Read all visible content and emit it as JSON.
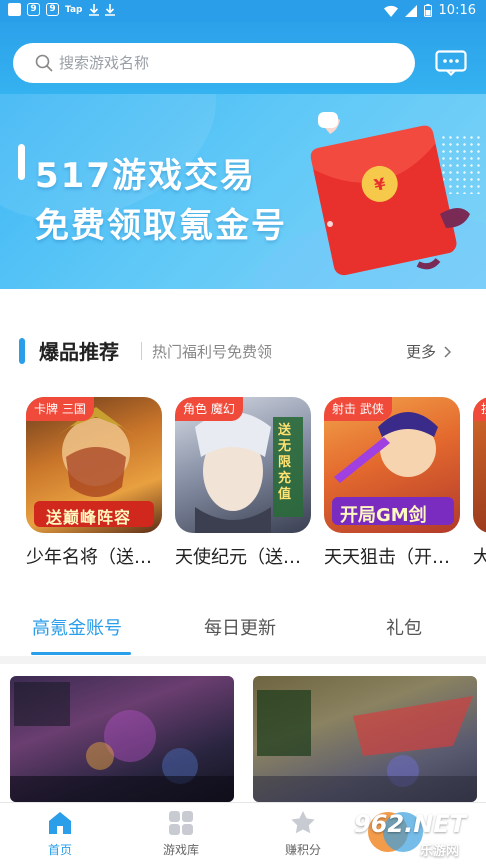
{
  "status_bar": {
    "time": "10:16",
    "tap_label": "Tap",
    "num1": "9",
    "num2": "9"
  },
  "search": {
    "placeholder": "搜索游戏名称"
  },
  "banner": {
    "line1": "517游戏交易",
    "line2": "免费领取氪金号",
    "coin_symbol": "¥"
  },
  "section": {
    "title": "爆品推荐",
    "subtitle": "热门福利号免费领",
    "more_label": "更多"
  },
  "games": [
    {
      "tag": "卡牌 三国",
      "name": "少年名将（送…",
      "art_text": "送巅峰阵容"
    },
    {
      "tag": "角色 魔幻",
      "name": "天使纪元（送…",
      "art_text": "送无限充值"
    },
    {
      "tag": "射击 武侠",
      "name": "天天狙击（开…",
      "art_text": "开局GM剑"
    },
    {
      "tag": "挂",
      "name": "大"
    }
  ],
  "tabs": [
    {
      "label": "高氪金账号",
      "active": true
    },
    {
      "label": "每日更新",
      "active": false
    },
    {
      "label": "礼包",
      "active": false
    }
  ],
  "bottom_nav": [
    {
      "label": "首页",
      "icon": "home-icon",
      "active": true
    },
    {
      "label": "游戏库",
      "icon": "grid-icon",
      "active": false
    },
    {
      "label": "赚积分",
      "icon": "star-icon",
      "active": false
    }
  ],
  "watermark": {
    "text": "962.NET",
    "sub": "乐游网"
  },
  "colors": {
    "accent": "#2a9ee8",
    "tag": "#ef4a3a",
    "banner": "#3fb7f5"
  }
}
